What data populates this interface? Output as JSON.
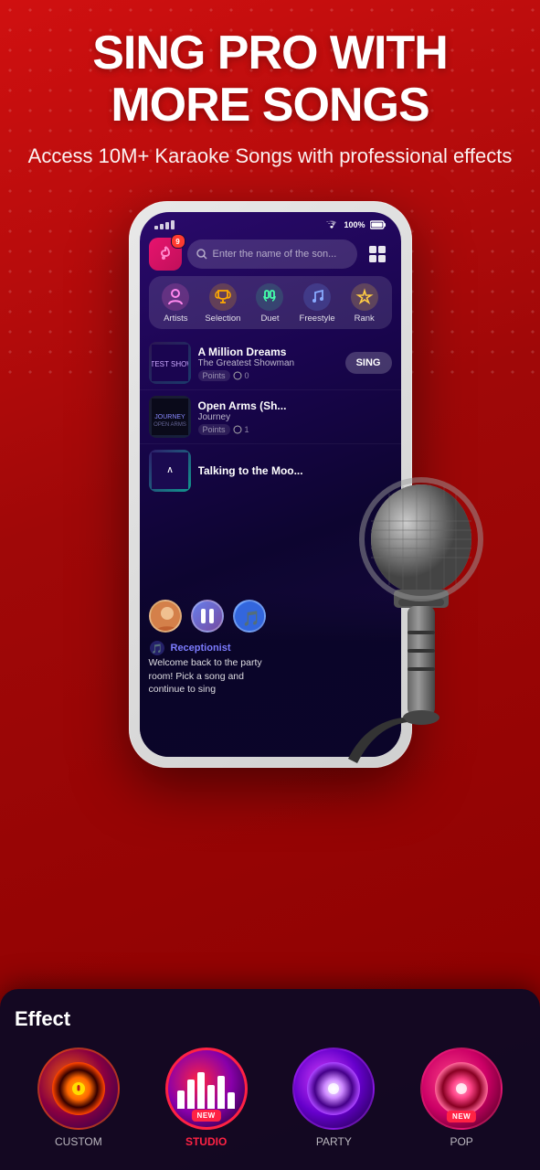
{
  "header": {
    "main_title_line1": "SING PRO WITH",
    "main_title_line2": "MORE SONGS",
    "subtitle": "Access 10M+ Karaoke Songs with professional effects"
  },
  "phone": {
    "search_placeholder": "Enter the name of the son...",
    "notification_count": "9",
    "categories": [
      {
        "id": "artists",
        "label": "Artists",
        "icon": "👤",
        "color": "#ff88ff"
      },
      {
        "id": "selection",
        "label": "Selection",
        "icon": "🏆",
        "color": "#ffaa00"
      },
      {
        "id": "duet",
        "label": "Duet",
        "icon": "🎤",
        "color": "#44ffaa"
      },
      {
        "id": "freestyle",
        "label": "Freestyle",
        "icon": "🎵",
        "color": "#88aaff"
      },
      {
        "id": "rank",
        "label": "Rank",
        "icon": "🥇",
        "color": "#ffcc44"
      }
    ],
    "songs": [
      {
        "title": "A Million Dreams",
        "artist": "The Greatest Showman",
        "points": "0",
        "has_sing_button": true,
        "thumb_color": "greatest"
      },
      {
        "title": "Open Arms (Sh...",
        "artist": "Journey",
        "points": "1",
        "has_sing_button": false,
        "thumb_color": "journey"
      },
      {
        "title": "Talking to the Moo...",
        "artist": "",
        "points": "",
        "has_sing_button": false,
        "thumb_color": "moon"
      }
    ],
    "chat": {
      "username": "Receptionist",
      "message_line1": "Welcome back to the party",
      "message_line2": "room! Pick a song and",
      "message_line3": "continue to sing"
    }
  },
  "effect_panel": {
    "title": "Effect",
    "items": [
      {
        "id": "custom",
        "label": "CUSTOM",
        "is_new": false,
        "label_color": "#aaaaaa"
      },
      {
        "id": "studio",
        "label": "STUDIO",
        "is_new": true,
        "label_color": "#ff2244"
      },
      {
        "id": "party",
        "label": "PARTY",
        "is_new": false,
        "label_color": "#aaaaaa"
      },
      {
        "id": "pop",
        "label": "POP",
        "is_new": true,
        "label_color": "#aaaaaa"
      }
    ]
  }
}
